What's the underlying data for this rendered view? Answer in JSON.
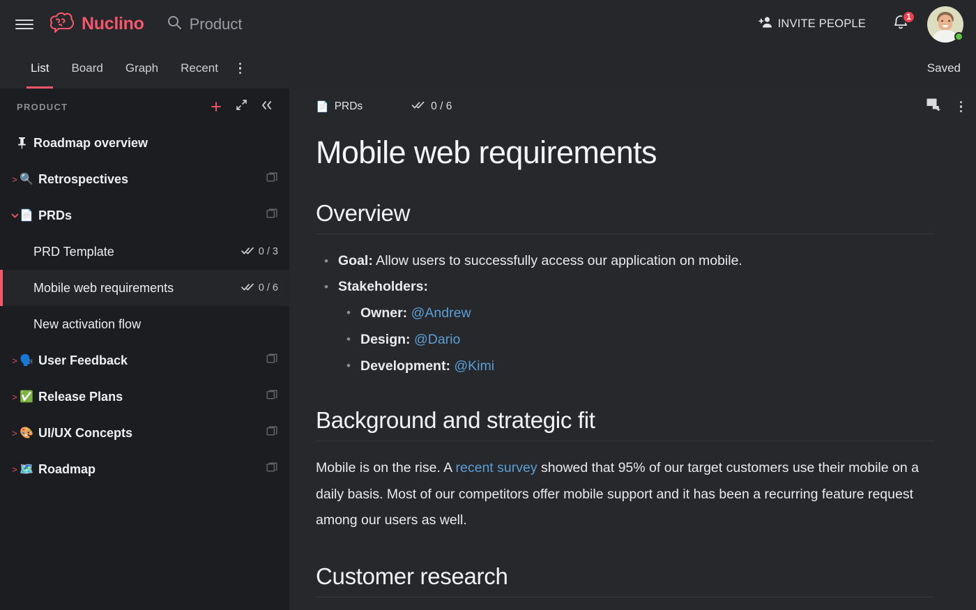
{
  "topbar": {
    "menu_icon": "hamburger-icon",
    "brand": "Nuclino",
    "brand_color": "#f4566a",
    "search_placeholder": "Product",
    "search_icon": "search-icon",
    "invite_label": "INVITE PEOPLE",
    "invite_icon": "add-person-icon",
    "bell_icon": "bell-icon",
    "notification_count": "1",
    "avatar_name": "user-avatar",
    "presence": "online"
  },
  "tabbar": {
    "tabs": [
      {
        "label": "List",
        "active": true
      },
      {
        "label": "Board",
        "active": false
      },
      {
        "label": "Graph",
        "active": false
      },
      {
        "label": "Recent",
        "active": false
      }
    ],
    "overflow_icon": "more-vertical-icon",
    "status": "Saved"
  },
  "sidebar": {
    "title": "PRODUCT",
    "actions": [
      {
        "name": "add-item-button",
        "icon": "plus-icon"
      },
      {
        "name": "expand-button",
        "icon": "expand-icon"
      },
      {
        "name": "collapse-sidebar-button",
        "icon": "chevron-double-left-icon"
      }
    ],
    "items": [
      {
        "label": "Roadmap overview",
        "icon": "pin-icon",
        "emoji": "",
        "caret": "",
        "bold": true,
        "indent": 0,
        "count": "",
        "cluster": false,
        "selected": false
      },
      {
        "label": "Retrospectives",
        "icon": "",
        "emoji": "🔍",
        "caret": ">",
        "bold": true,
        "indent": 0,
        "count": "",
        "cluster": true,
        "selected": false
      },
      {
        "label": "PRDs",
        "icon": "",
        "emoji": "📄",
        "caret": "v",
        "bold": true,
        "indent": 0,
        "count": "",
        "cluster": true,
        "selected": false
      },
      {
        "label": "PRD Template",
        "icon": "",
        "emoji": "",
        "caret": "",
        "bold": false,
        "indent": 1,
        "count": "0 / 3",
        "cluster": false,
        "selected": false
      },
      {
        "label": "Mobile web requirements",
        "icon": "",
        "emoji": "",
        "caret": "",
        "bold": false,
        "indent": 1,
        "count": "0 / 6",
        "cluster": false,
        "selected": true
      },
      {
        "label": "New activation flow",
        "icon": "",
        "emoji": "",
        "caret": "",
        "bold": false,
        "indent": 1,
        "count": "",
        "cluster": false,
        "selected": false
      },
      {
        "label": "User Feedback",
        "icon": "",
        "emoji": "🗣️",
        "caret": ">",
        "bold": true,
        "indent": 0,
        "count": "",
        "cluster": true,
        "selected": false
      },
      {
        "label": "Release Plans",
        "icon": "",
        "emoji": "✅",
        "caret": ">",
        "bold": true,
        "indent": 0,
        "count": "",
        "cluster": true,
        "selected": false
      },
      {
        "label": "UI/UX Concepts",
        "icon": "",
        "emoji": "🎨",
        "caret": ">",
        "bold": true,
        "indent": 0,
        "count": "",
        "cluster": true,
        "selected": false
      },
      {
        "label": "Roadmap",
        "icon": "",
        "emoji": "🗺️",
        "caret": ">",
        "bold": true,
        "indent": 0,
        "count": "",
        "cluster": true,
        "selected": false
      }
    ]
  },
  "document": {
    "breadcrumb": "PRDs",
    "breadcrumb_emoji": "📄",
    "task_count": "0 / 6",
    "comment_icon": "comment-icon",
    "more_icon": "more-vertical-icon",
    "title": "Mobile web requirements",
    "sections": [
      {
        "heading": "Overview",
        "bullets": [
          {
            "bold": "Goal:",
            "text": " Allow users to successfully access our application on mobile."
          },
          {
            "bold": "Stakeholders:",
            "text": ""
          }
        ],
        "subbullets": [
          {
            "bold": "Owner:",
            "mention": "@Andrew"
          },
          {
            "bold": "Design:",
            "mention": "@Dario"
          },
          {
            "bold": "Development:",
            "mention": "@Kimi"
          }
        ]
      },
      {
        "heading": "Background and strategic fit",
        "paragraph_pre": "Mobile is on the rise. A ",
        "paragraph_link": "recent survey",
        "paragraph_post": " showed that 95% of our target customers use their mobile on a daily basis. Most of our competitors offer mobile support and it has been a recurring feature request among our users as well."
      },
      {
        "heading": "Customer research"
      }
    ]
  },
  "colors": {
    "accent": "#f4566a",
    "link": "#5b9fd6",
    "sidebar_bg": "#1b1d20",
    "main_bg": "#26282c",
    "topbar_bg": "#25272b",
    "online": "#5bc940",
    "badge": "#ec3f50"
  }
}
